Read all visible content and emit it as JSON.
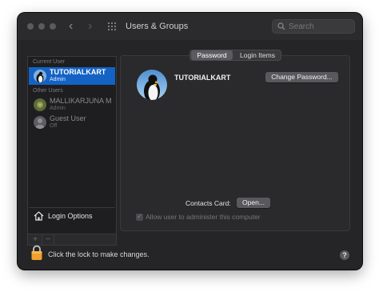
{
  "window": {
    "title": "Users & Groups",
    "search_placeholder": "Search",
    "back_glyph": "‹",
    "forward_glyph": "›"
  },
  "sidebar": {
    "current_header": "Current User",
    "other_header": "Other Users",
    "users": [
      {
        "name": "TUTORIALKART",
        "role": "Admin",
        "selected": true,
        "avatar": "penguin-avatar"
      },
      {
        "name": "MALLIKARJUNA M",
        "role": "Admin",
        "selected": false,
        "avatar": "flower-avatar"
      },
      {
        "name": "Guest User",
        "role": "Off",
        "selected": false,
        "avatar": "generic-user-avatar"
      }
    ],
    "login_options": "Login Options",
    "add_label": "+",
    "remove_label": "−"
  },
  "tabs": [
    {
      "label": "Password",
      "active": true
    },
    {
      "label": "Login Items",
      "active": false
    }
  ],
  "main": {
    "user_name": "TUTORIALKART",
    "change_password": "Change Password...",
    "contacts_card_label": "Contacts Card:",
    "open_button": "Open...",
    "allow_admin": "Allow user to administer this computer",
    "allow_admin_checked": true
  },
  "footer": {
    "lock_text": "Click the lock to make changes.",
    "help_label": "?"
  },
  "colors": {
    "selection": "#1463c4",
    "lock": "#f0a030"
  }
}
